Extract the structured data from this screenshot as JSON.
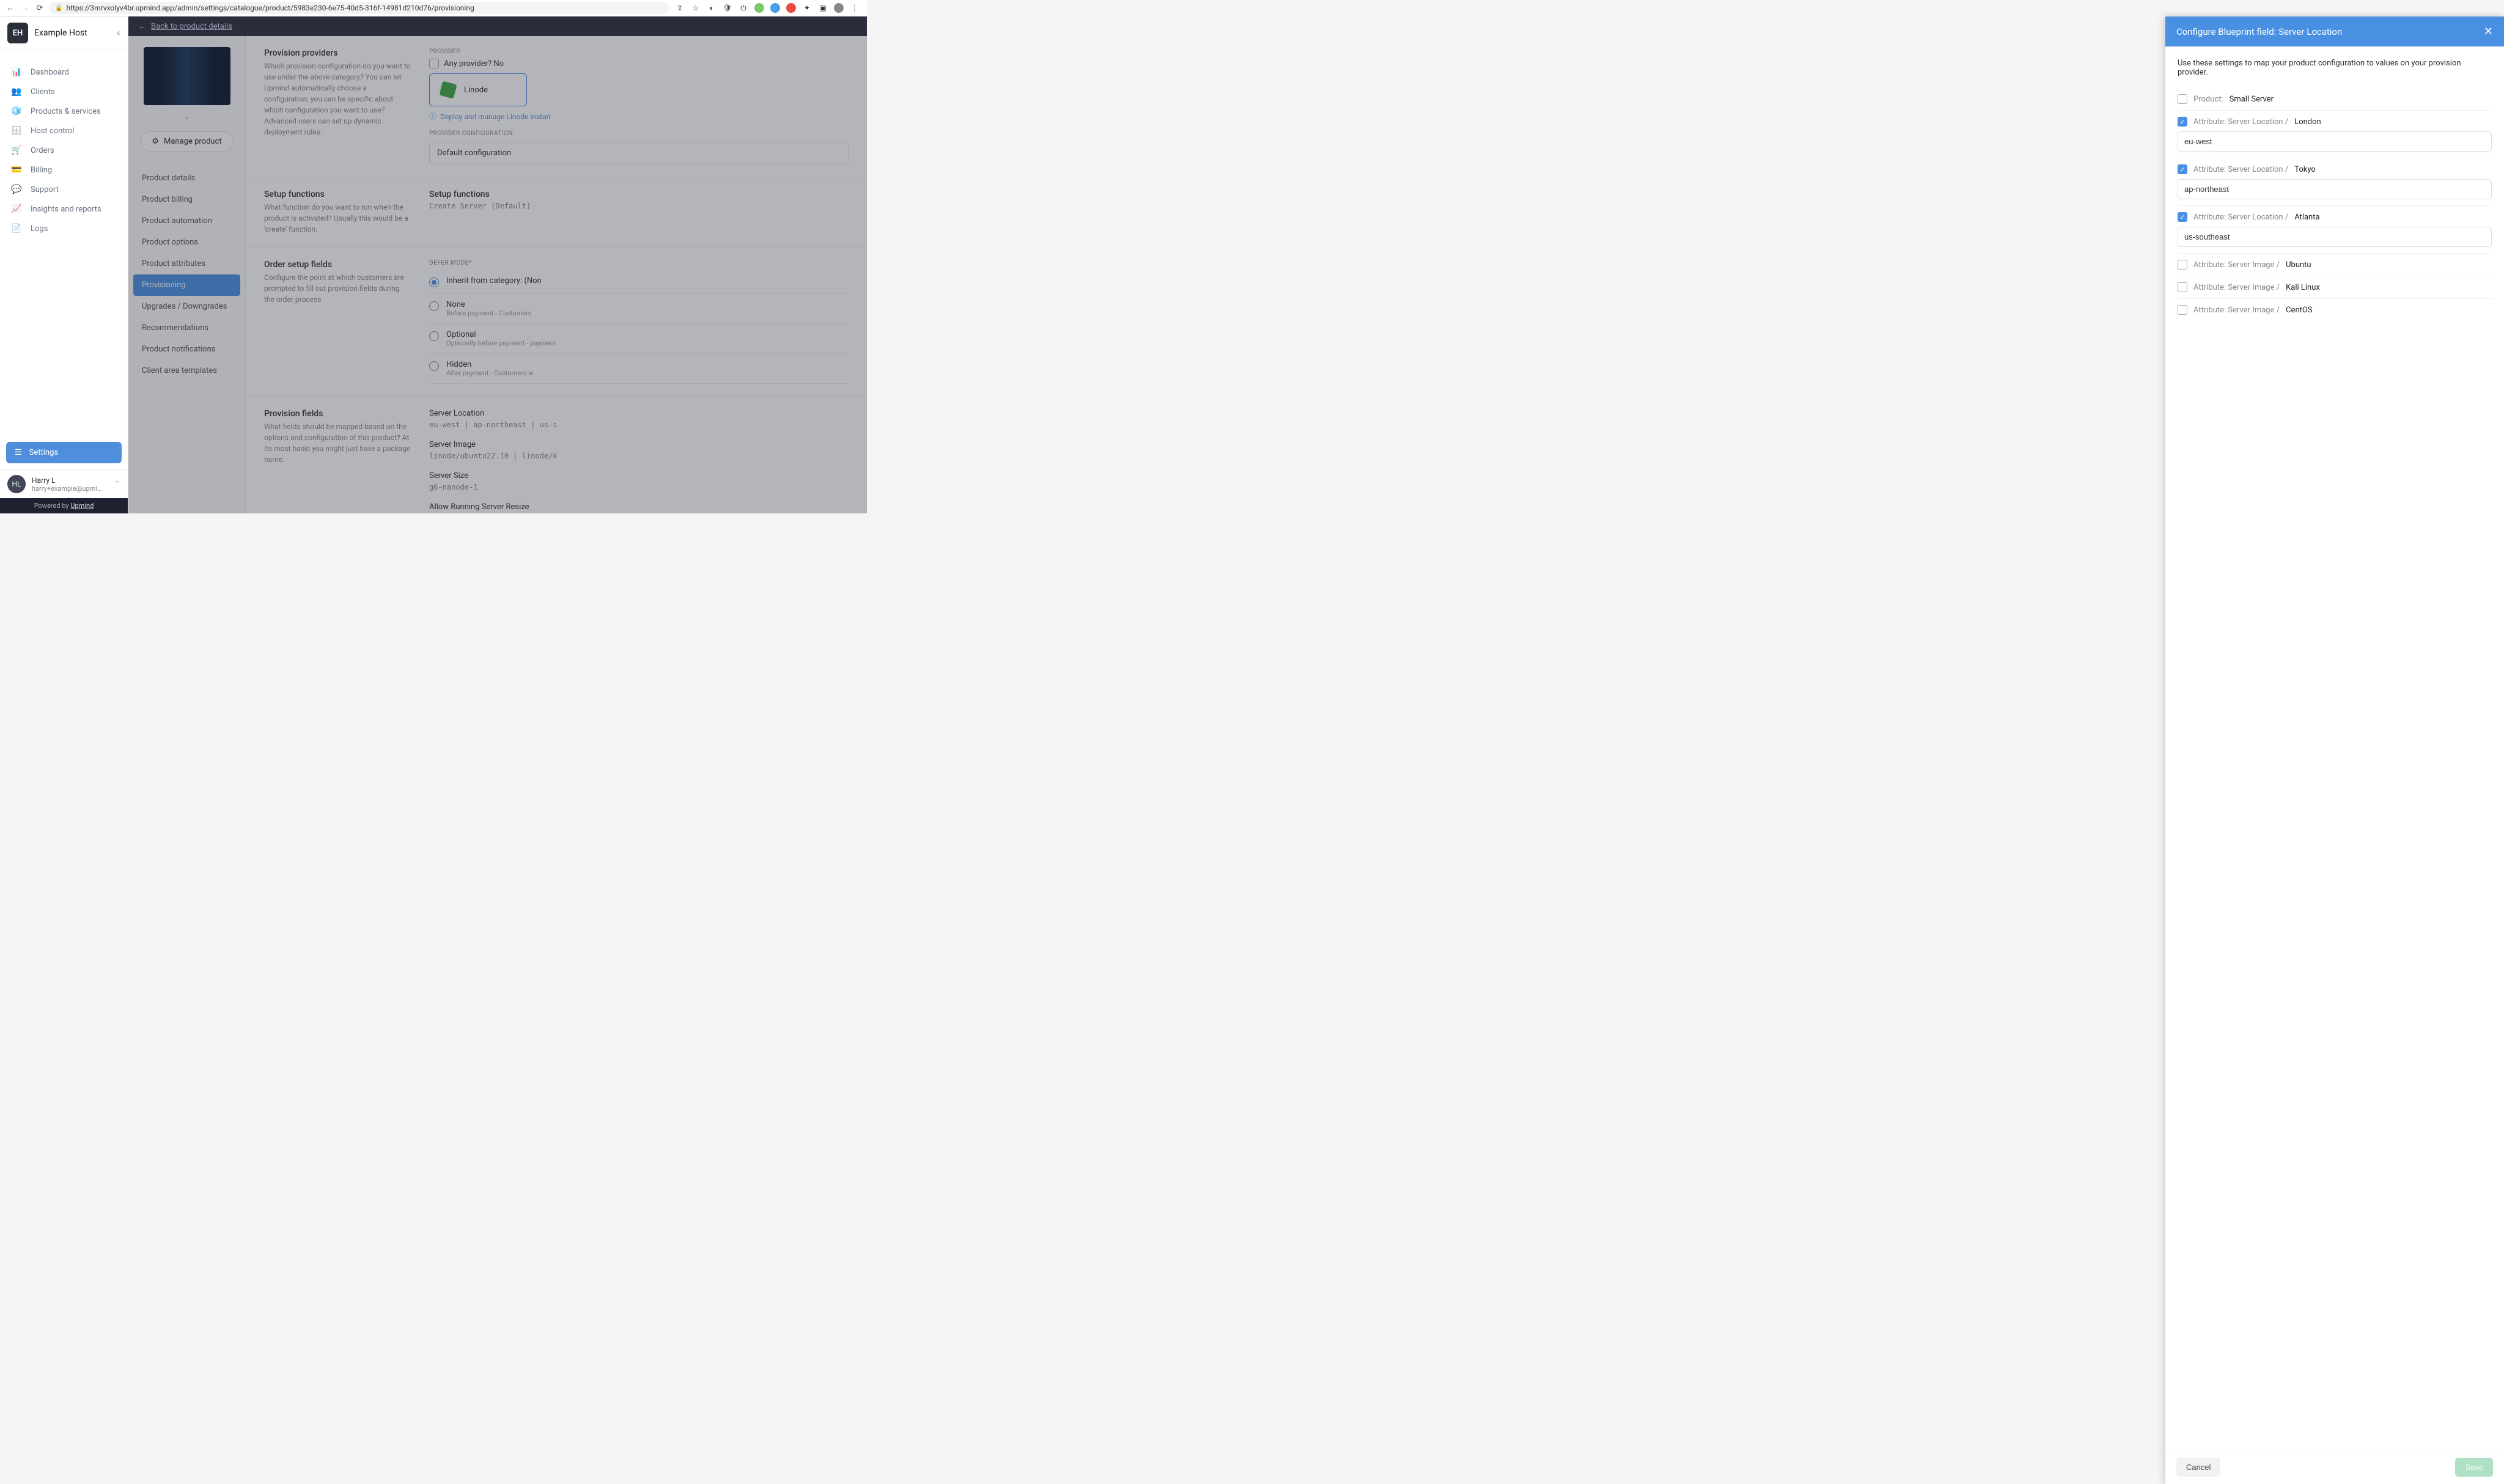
{
  "url": "https://3mrvxolyv4br.upmind.app/admin/settings/catalogue/product/5983e230-6e75-40d5-316f-14981d210d76/provisioning",
  "brand": {
    "badge": "EH",
    "name": "Example Host"
  },
  "nav": [
    {
      "icon": "📊",
      "label": "Dashboard"
    },
    {
      "icon": "👥",
      "label": "Clients"
    },
    {
      "icon": "🧊",
      "label": "Products & services"
    },
    {
      "icon": "🗄",
      "label": "Host control"
    },
    {
      "icon": "🛒",
      "label": "Orders"
    },
    {
      "icon": "💳",
      "label": "Billing"
    },
    {
      "icon": "💬",
      "label": "Support"
    },
    {
      "icon": "📈",
      "label": "Insights and reports"
    },
    {
      "icon": "📄",
      "label": "Logs"
    }
  ],
  "settings_label": "Settings",
  "user": {
    "initials": "HL",
    "name": "Harry L",
    "email": "harry+example@upmind...."
  },
  "powered": {
    "prefix": "Powered by ",
    "brand": "Upmind"
  },
  "breadcrumb": "Back to product details",
  "manage_label": "Manage product",
  "subnav": [
    "Product details",
    "Product billing",
    "Product automation",
    "Product options",
    "Product attributes",
    "Provisioning",
    "Upgrades / Downgrades",
    "Recommendations",
    "Product notifications",
    "Client area templates"
  ],
  "subnav_active": 5,
  "sections": {
    "providers": {
      "title": "Provision providers",
      "desc": "Which provision configuration do you want to use under the above category? You can let Upmind automatically choose a configuration, you can be specific about which configuration you want to use? Advanced users can set up dynamic deployment rules.",
      "provider_label": "PROVIDER",
      "any_label": "Any provider? No",
      "card_name": "Linode",
      "deploy_text": "Deploy and manage Linode instan",
      "config_label": "PROVIDER CONFIGURATION",
      "config_value": "Default configuration"
    },
    "setup": {
      "title": "Setup functions",
      "desc": "What function do you want to run when the product is activated? Usually this would be a 'create' function.",
      "right_title": "Setup functions",
      "right_code": "Create Server (Default)"
    },
    "order": {
      "title": "Order setup fields",
      "desc": "Configure the point at which customers are prompted to fill out provision fields during the order process",
      "defer_label": "DEFER MODE*",
      "options": [
        {
          "label": "Inherit from category: (Non",
          "sub": "",
          "checked": true
        },
        {
          "label": "None",
          "sub": "Before payment - Customers",
          "checked": false
        },
        {
          "label": "Optional",
          "sub": "Optionally before payment - payment",
          "checked": false
        },
        {
          "label": "Hidden",
          "sub": "After payment - Customers w",
          "checked": false
        }
      ]
    },
    "fields": {
      "title": "Provision fields",
      "desc": "What fields should be mapped based on the options and configuration of this product? At its most basic you might just have a package name.",
      "items": [
        {
          "name": "Server Location",
          "vals": "eu-west | ap-northeast | us-s"
        },
        {
          "name": "Server Image",
          "vals": "linode/ubuntu22.10 | linode/k"
        },
        {
          "name": "Server Size",
          "vals": "g6-nanode-1"
        },
        {
          "name": "Allow Running Server Resize",
          "vals": "-"
        }
      ]
    }
  },
  "drawer": {
    "title": "Configure Blueprint field: Server Location",
    "desc": "Use these settings to map your product configuration to values on your provision provider.",
    "rows": [
      {
        "checked": false,
        "label": "Product:",
        "value": "Small Server",
        "input": null
      },
      {
        "checked": true,
        "label": "Attribute: Server Location /",
        "value": "London",
        "input": "eu-west"
      },
      {
        "checked": true,
        "label": "Attribute: Server Location /",
        "value": "Tokyo",
        "input": "ap-northeast"
      },
      {
        "checked": true,
        "label": "Attribute: Server Location /",
        "value": "Atlanta",
        "input": "us-southeast"
      },
      {
        "checked": false,
        "label": "Attribute: Server Image /",
        "value": "Ubuntu",
        "input": null
      },
      {
        "checked": false,
        "label": "Attribute: Server Image /",
        "value": "Kali Linux",
        "input": null
      },
      {
        "checked": false,
        "label": "Attribute: Server Image /",
        "value": "CentOS",
        "input": null
      }
    ],
    "cancel": "Cancel",
    "save": "Save"
  }
}
